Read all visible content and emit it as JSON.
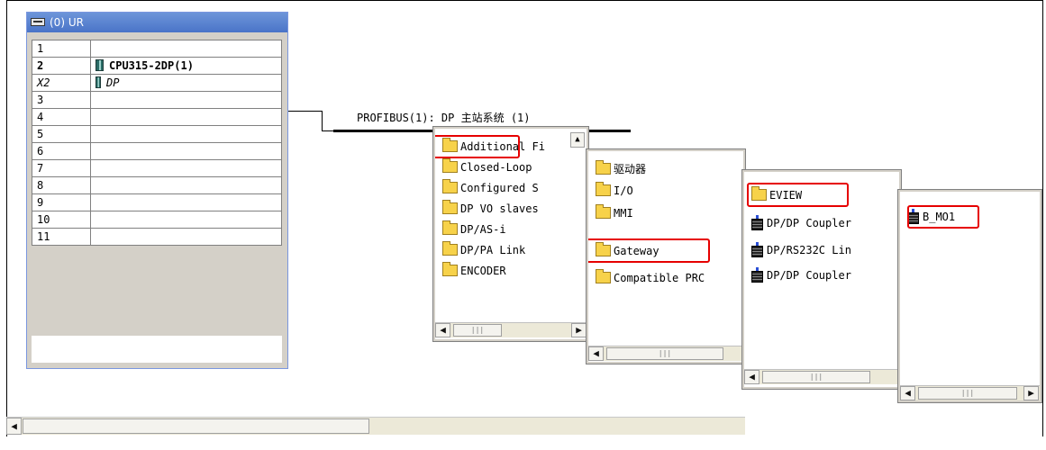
{
  "rack": {
    "title": "(0) UR",
    "slots": [
      {
        "slot": "1",
        "module": ""
      },
      {
        "slot": "2",
        "module": "CPU315-2DP(1)"
      },
      {
        "slot": "X2",
        "module": "DP"
      },
      {
        "slot": "3",
        "module": ""
      },
      {
        "slot": "4",
        "module": ""
      },
      {
        "slot": "5",
        "module": ""
      },
      {
        "slot": "6",
        "module": ""
      },
      {
        "slot": "7",
        "module": ""
      },
      {
        "slot": "8",
        "module": ""
      },
      {
        "slot": "9",
        "module": ""
      },
      {
        "slot": "10",
        "module": ""
      },
      {
        "slot": "11",
        "module": ""
      }
    ]
  },
  "bus": {
    "label": "PROFIBUS(1): DP 主站系统 (1)"
  },
  "catalog": {
    "pane1": {
      "items": [
        "Additional Fi",
        "Closed-Loop",
        "Configured S",
        "DP VO slaves",
        "DP/AS-i",
        "DP/PA Link",
        "ENCODER"
      ]
    },
    "pane2": {
      "items": [
        "驱动器",
        "I/O",
        "MMI",
        "Gateway",
        "Compatible PRC"
      ]
    },
    "pane3": {
      "items": [
        "EVIEW",
        "DP/DP Coupler",
        "DP/RS232C Lin",
        "DP/DP Coupler"
      ]
    },
    "pane4": {
      "items": [
        "B_MO1"
      ]
    }
  },
  "highlighted": [
    "Additional Fi",
    "Gateway",
    "EVIEW",
    "B_MO1"
  ],
  "icons": {
    "scroll_left": "◀-arrow",
    "scroll_right": "▶-arrow",
    "folder": "folder-icon",
    "device": "device-icon"
  },
  "colors": {
    "highlight": "#e60000",
    "title_bar": "#4a74c8",
    "folder": "#f7d24a"
  }
}
